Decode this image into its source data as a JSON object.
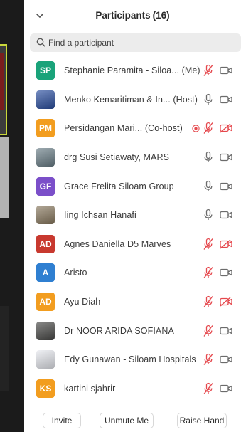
{
  "panel": {
    "title": "Participants",
    "count": "(16)"
  },
  "search": {
    "placeholder": "Find a participant"
  },
  "participants": [
    {
      "initials": "SP",
      "name": "Stephanie Paramita - Siloa... (Me)",
      "avatar_color": "#1aa37a",
      "mic": "muted",
      "cam": "off"
    },
    {
      "initials": "",
      "name": "Menko Kemaritiman & In... (Host)",
      "avatar_color": "#2b4fa0",
      "mic": "on",
      "cam": "off"
    },
    {
      "initials": "PM",
      "name": "Persidangan Mari... (Co-host)",
      "avatar_color": "#f29d1f",
      "mic": "muted",
      "cam": "blocked",
      "recording": true
    },
    {
      "initials": "",
      "name": "drg Susi Setiawaty, MARS",
      "avatar_color": "#6b7f88",
      "mic": "on",
      "cam": "off"
    },
    {
      "initials": "GF",
      "name": "Grace Frelita Siloam Group",
      "avatar_color": "#7b4fc9",
      "mic": "on",
      "cam": "off"
    },
    {
      "initials": "",
      "name": "Iing Ichsan Hanafi",
      "avatar_color": "#8a7a60",
      "mic": "on",
      "cam": "off"
    },
    {
      "initials": "AD",
      "name": "Agnes Daniella D5 Marves",
      "avatar_color": "#c8392f",
      "mic": "muted",
      "cam": "blocked"
    },
    {
      "initials": "A",
      "name": "Aristo",
      "avatar_color": "#2f7fd1",
      "mic": "muted",
      "cam": "off"
    },
    {
      "initials": "AD",
      "name": "Ayu Diah",
      "avatar_color": "#f29d1f",
      "mic": "muted",
      "cam": "blocked"
    },
    {
      "initials": "",
      "name": "Dr NOOR ARIDA SOFIANA",
      "avatar_color": "#4a4a48",
      "mic": "muted",
      "cam": "off"
    },
    {
      "initials": "",
      "name": "Edy Gunawan - Siloam Hospitals",
      "avatar_color": "#e6e8ee",
      "mic": "muted",
      "cam": "off"
    },
    {
      "initials": "KS",
      "name": "kartini sjahrir",
      "avatar_color": "#f29d1f",
      "mic": "muted",
      "cam": "off"
    }
  ],
  "footer": {
    "invite": "Invite",
    "unmute": "Unmute Me",
    "raise_hand": "Raise Hand"
  },
  "colors": {
    "muted_red": "#e5484d",
    "icon_gray": "#6b6b6b",
    "recording_red": "#e5484d"
  }
}
